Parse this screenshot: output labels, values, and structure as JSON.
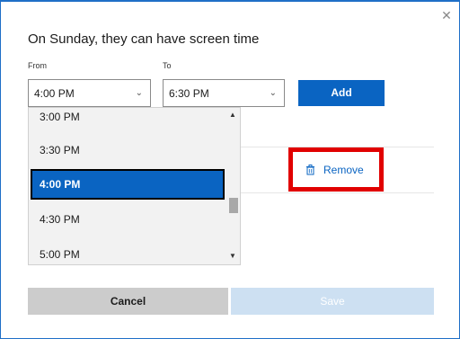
{
  "dialog": {
    "title": "On Sunday, they can have screen time",
    "close_icon": "close-icon"
  },
  "form": {
    "from_label": "From",
    "to_label": "To",
    "from_value": "4:00 PM",
    "to_value": "6:30 PM",
    "add_label": "Add"
  },
  "schedule": {
    "remove_label": "Remove",
    "remove_icon": "trash-icon",
    "highlight_color": "#e10000"
  },
  "dropdown": {
    "options": [
      "3:00 PM",
      "3:30 PM",
      "4:00 PM",
      "4:30 PM",
      "5:00 PM"
    ],
    "selected": "4:00 PM"
  },
  "footer": {
    "cancel_label": "Cancel",
    "save_label": "Save"
  },
  "colors": {
    "accent": "#0a64c2",
    "save_disabled": "#cde0f2",
    "cancel_bg": "#cccccc"
  }
}
